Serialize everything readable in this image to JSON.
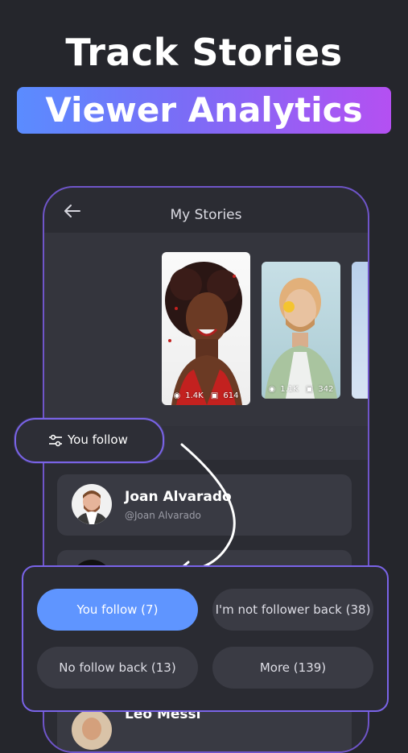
{
  "headline": "Track Stories",
  "banner": "Viewer Analytics",
  "screen": {
    "title": "My Stories"
  },
  "stories": [
    {
      "views": "1.4K",
      "replies": "614"
    },
    {
      "views": "1.1K",
      "replies": "342"
    }
  ],
  "filter_pill": {
    "label": "You follow"
  },
  "users": [
    {
      "name": "Joan Alvarado",
      "handle": "@Joan Alvarado"
    },
    {
      "name": "Leo Messi"
    }
  ],
  "filter_options": [
    {
      "label": "You follow (7)",
      "active": true
    },
    {
      "label": "I'm not follower back (38)",
      "active": false
    },
    {
      "label": "No follow back (13)",
      "active": false
    },
    {
      "label": "More (139)",
      "active": false
    }
  ],
  "colors": {
    "background": "#25262c",
    "accent_blue": "#5f95ff",
    "accent_purple": "#7a64e8",
    "banner_gradient": [
      "#5a8cff",
      "#b450f2"
    ]
  },
  "icons": [
    "back-arrow-icon",
    "eye-icon",
    "reply-icon",
    "sliders-icon",
    "curved-arrow-icon"
  ]
}
